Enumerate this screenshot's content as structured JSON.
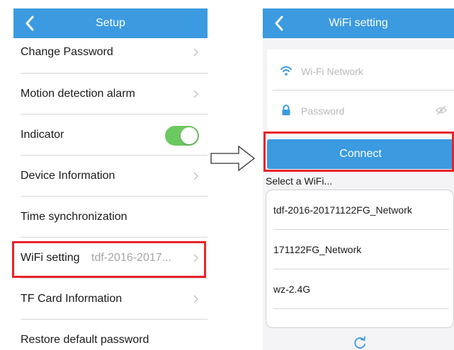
{
  "left_screen": {
    "title": "Setup",
    "rows": [
      {
        "label": "Change Password"
      },
      {
        "label": "Motion detection alarm"
      },
      {
        "label": "Indicator",
        "toggle_on": true
      },
      {
        "label": "Device Information"
      },
      {
        "label": "Time synchronization"
      },
      {
        "label": "WiFi setting",
        "value": "tdf-2016-2017..."
      },
      {
        "label": "TF Card Information"
      },
      {
        "label": "Restore default password"
      }
    ]
  },
  "right_screen": {
    "title": "WiFi setting",
    "network_placeholder": "Wi-Fi Network",
    "password_placeholder": "Password",
    "connect_label": "Connect",
    "select_label": "Select a WiFi...",
    "networks": [
      "tdf-2016-20171122FG_Network",
      "171122FG_Network",
      "wz-2.4G"
    ]
  },
  "colors": {
    "navbar": "#3b9ae0",
    "accent": "#3b9ae0",
    "toggle_on": "#6cc860",
    "highlight": "#e8242a"
  },
  "icons": {
    "back": "chevron-left-icon",
    "disclosure": "chevron-right-icon",
    "wifi": "wifi-icon",
    "lock": "lock-icon",
    "eye": "eye-hidden-icon",
    "refresh": "refresh-icon",
    "arrow": "right-arrow-icon"
  }
}
